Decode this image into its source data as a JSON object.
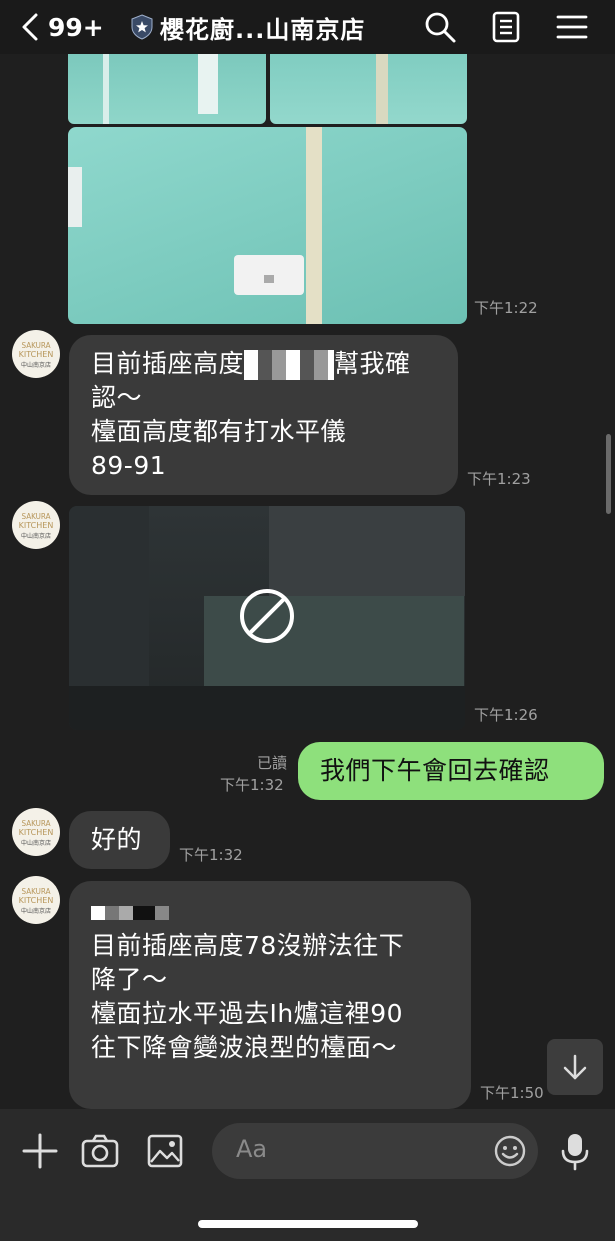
{
  "header": {
    "unread_count": "99+",
    "title": "櫻花廚...山南京店"
  },
  "messages": {
    "m1_time": "下午1:22",
    "m2_line1": "目前插座高度",
    "m2_line1b": "幫我確",
    "m2_line2": "認～",
    "m2_line3": "檯面高度都有打水平儀",
    "m2_line4": "89-91",
    "m2_time": "下午1:23",
    "m3_time": "下午1:26",
    "m4_read": "已讀",
    "m4_time": "下午1:32",
    "m4_text": "我們下午會回去確認",
    "m5_text": "好的",
    "m5_time": "下午1:32",
    "m6_line2": "目前插座高度78沒辦法往下",
    "m6_line3": "降了～",
    "m6_line4": "檯面拉水平過去Ih爐這裡90",
    "m6_line5": "往下降會變波浪型的檯面～",
    "m6_time": "下午1:50"
  },
  "avatar": {
    "line1": "SAKURA",
    "line2": "KITCHEN",
    "line3": "中山南京店"
  },
  "input": {
    "placeholder": "Aa"
  },
  "icons": [
    "chevron-left-icon",
    "shield-star-icon",
    "search-icon",
    "notes-icon",
    "menu-icon",
    "plus-icon",
    "camera-icon",
    "image-icon",
    "emoji-icon",
    "microphone-icon",
    "arrow-down-icon",
    "blocked-icon"
  ],
  "colors": {
    "my_bubble": "#8ee07c",
    "their_bubble": "#3a3a3a",
    "background": "#1f1f1f"
  }
}
